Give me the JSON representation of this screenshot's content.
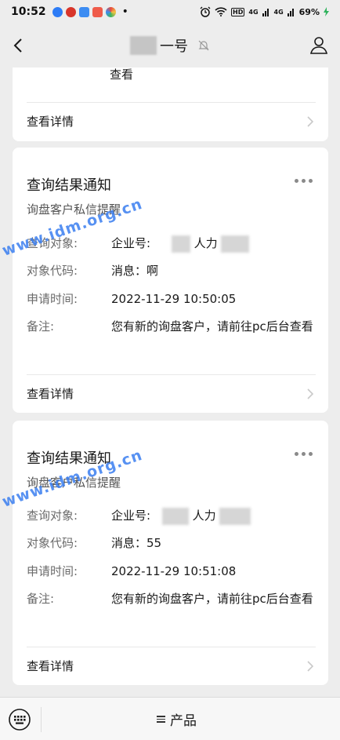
{
  "status_bar": {
    "time": "10:52",
    "dot": "•",
    "network_badge": "HD",
    "signal_1": "4G",
    "signal_2": "4G",
    "battery": "69%"
  },
  "header": {
    "title_suffix": "一号",
    "back_icon": "back-chevron-icon",
    "profile_icon": "person-icon",
    "mute_icon": "bell-muted-icon"
  },
  "top_card": {
    "remark_tail": "查看",
    "detail_link": "查看详情"
  },
  "cards": [
    {
      "title": "查询结果通知",
      "subtitle": "询盘客户私信提醒",
      "rows": [
        {
          "label": "查询对象:",
          "value_prefix": "企业号:",
          "value_mid": "人力"
        },
        {
          "label": "对象代码:",
          "value": "消息：啊"
        },
        {
          "label": "申请时间:",
          "value": "2022-11-29 10:50:05"
        },
        {
          "label": "备注:",
          "value": "您有新的询盘客户，请前往pc后台查看"
        }
      ],
      "detail_link": "查看详情"
    },
    {
      "title": "查询结果通知",
      "subtitle": "询盘客户私信提醒",
      "rows": [
        {
          "label": "查询对象:",
          "value_prefix": "企业号:",
          "value_mid": "人力"
        },
        {
          "label": "对象代码:",
          "value": "消息：55"
        },
        {
          "label": "申请时间:",
          "value": "2022-11-29 10:51:08"
        },
        {
          "label": "备注:",
          "value": "您有新的询盘客户，请前往pc后台查看"
        }
      ],
      "detail_link": "查看详情"
    }
  ],
  "watermark": "www.idm.org.cn",
  "bottom_bar": {
    "menu_label": "产品",
    "keyboard_icon": "keyboard-icon"
  },
  "colors": {
    "background": "#ededed",
    "card": "#ffffff",
    "watermark": "#3a7ef0"
  }
}
